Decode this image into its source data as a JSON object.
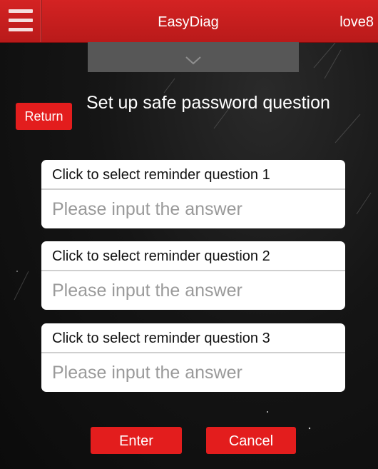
{
  "header": {
    "title": "EasyDiag",
    "user": "love8",
    "menu_icon": "hamburger-menu-icon",
    "colors": {
      "bar": "#c81f1f",
      "accent": "#e31d1d"
    }
  },
  "pull_tab": {
    "icon": "chevron-down-icon"
  },
  "return_label": "Return",
  "page_title": "Set up safe password question",
  "questions": [
    {
      "select_label": "Click to select reminder question 1",
      "answer_placeholder": "Please input the answer",
      "answer_value": ""
    },
    {
      "select_label": "Click to select reminder question 2",
      "answer_placeholder": "Please input the answer",
      "answer_value": ""
    },
    {
      "select_label": "Click to select reminder question 3",
      "answer_placeholder": "Please input the answer",
      "answer_value": ""
    }
  ],
  "actions": {
    "enter_label": "Enter",
    "cancel_label": "Cancel"
  }
}
